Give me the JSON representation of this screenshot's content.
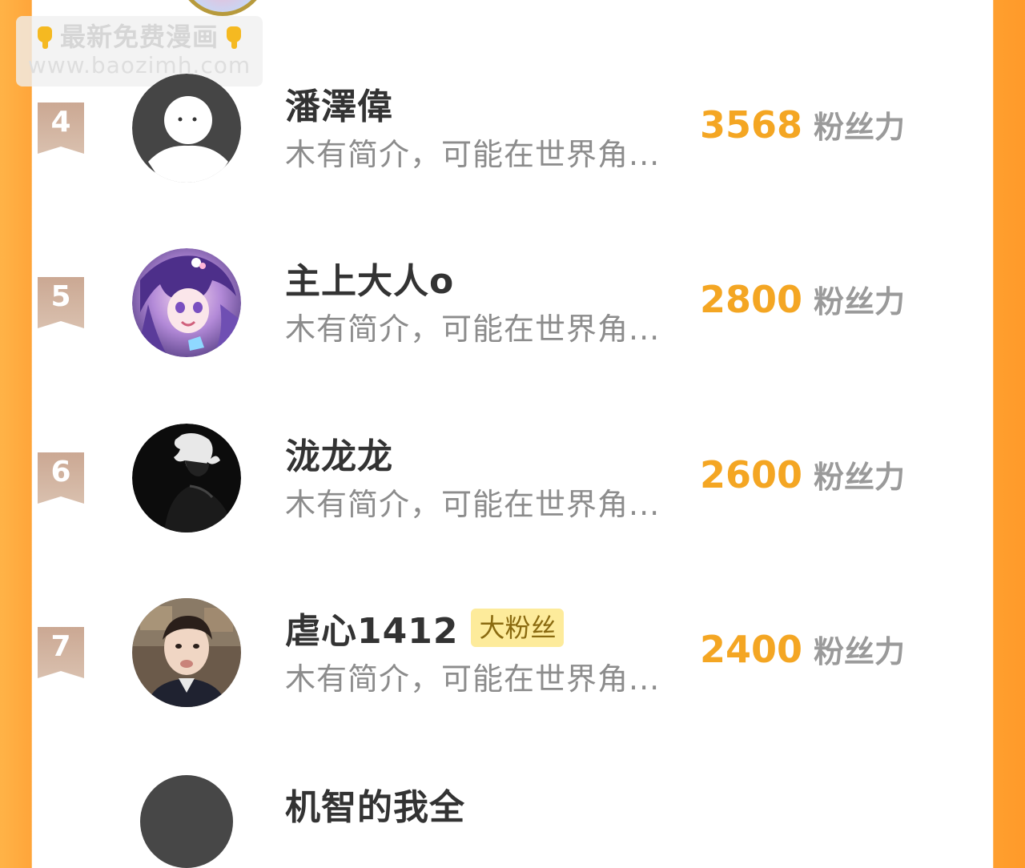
{
  "watermark": {
    "line1": "最新免费漫画",
    "line2": "www.baozimh.com",
    "icon": "pointing-down-hand-icon"
  },
  "colors": {
    "accent": "#f4a623",
    "badge": "#d2b19a",
    "side_left": "#ffb347",
    "side_right": "#ff9a2a"
  },
  "fans_unit": "粉丝力",
  "rows": [
    {
      "rank": "4",
      "name": "潘澤偉",
      "tag": "",
      "bio": "木有简介，可能在世界角...",
      "fans": "3568",
      "avatar": "default-person-avatar"
    },
    {
      "rank": "5",
      "name": "主上大人o",
      "tag": "",
      "bio": "木有简介，可能在世界角...",
      "fans": "2800",
      "avatar": "anime-girl-avatar"
    },
    {
      "rank": "6",
      "name": "泷龙龙",
      "tag": "",
      "bio": "木有简介，可能在世界角...",
      "fans": "2600",
      "avatar": "dark-figure-avatar"
    },
    {
      "rank": "7",
      "name": "虐心1412",
      "tag": "大粉丝",
      "bio": "木有简介，可能在世界角...",
      "fans": "2400",
      "avatar": "boy-photo-avatar"
    }
  ],
  "partial_bottom_name": "机智的我全"
}
